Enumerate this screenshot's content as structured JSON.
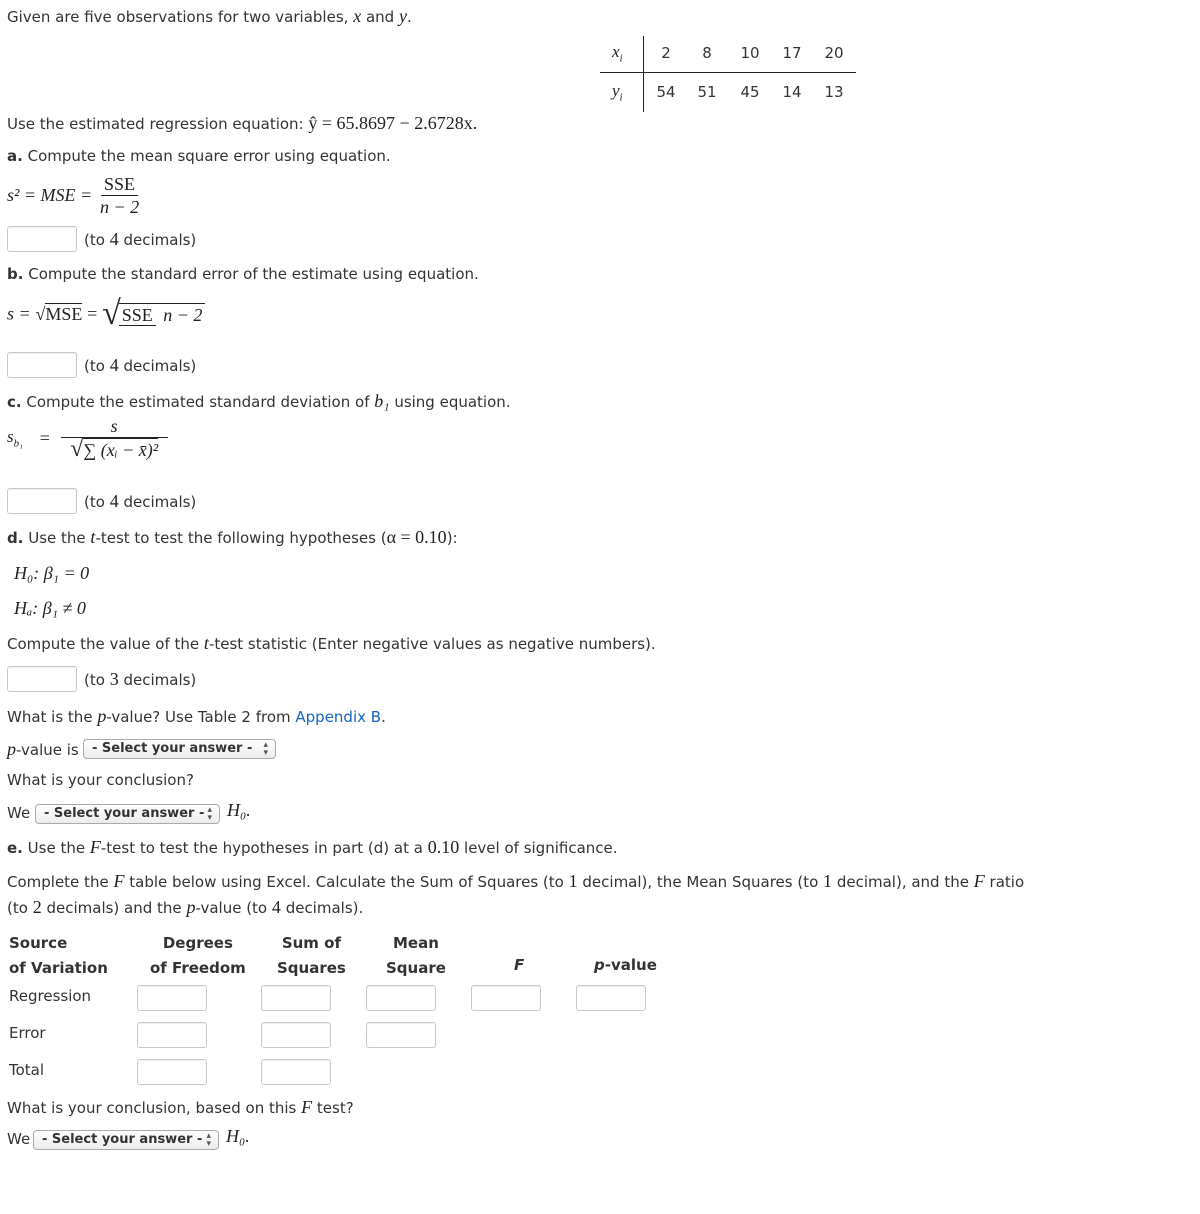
{
  "intro": {
    "text": "Given are five observations for two variables,",
    "var_x": "x",
    "and": "and",
    "var_y": "y",
    "period": "."
  },
  "observations": {
    "x_label": "x",
    "x_sub": "i",
    "y_label": "y",
    "y_sub": "i",
    "x_values": [
      "2",
      "8",
      "10",
      "17",
      "20"
    ],
    "y_values": [
      "54",
      "51",
      "45",
      "14",
      "13"
    ]
  },
  "regression": {
    "prefix": "Use the estimated regression equation:",
    "equation": "ŷ = 65.8697 − 2.6728x."
  },
  "part_a": {
    "letter": "a.",
    "text": "Compute the mean square error using equation.",
    "lhs": "s² = MSE =",
    "num": "SSE",
    "den": "n − 2",
    "input_value": "",
    "hint_pre": "(to",
    "hint_num": "4",
    "hint_post": "decimals)"
  },
  "part_b": {
    "letter": "b.",
    "text": "Compute the standard error of the estimate using equation.",
    "lhs_s": "s =",
    "mse": "MSE",
    "eq": "=",
    "num": "SSE",
    "den": "n − 2",
    "input_value": "",
    "hint_pre": "(to",
    "hint_num": "4",
    "hint_post": "decimals)"
  },
  "part_c": {
    "letter": "c.",
    "text_pre": "Compute the estimated standard deviation of",
    "b1": "b₁",
    "text_post": "using equation.",
    "lhs": "s",
    "lhs_sub": "b₁",
    "eq": "=",
    "num": "s",
    "den": "∑ (xᵢ − x̄)²",
    "input_value": "",
    "hint_pre": "(to",
    "hint_num": "4",
    "hint_post": "decimals)"
  },
  "part_d": {
    "letter": "d.",
    "text_pre": "Use the",
    "t": "t",
    "text_mid": "-test to test the following hypotheses (",
    "alpha": "α = 0.10",
    "text_post": "):",
    "h0": "H₀:  β₁ = 0",
    "ha": "Hₐ:  β₁ ≠ 0",
    "compute_pre": "Compute the value of the",
    "compute_post": "-test statistic (Enter negative values as negative numbers).",
    "input_value": "",
    "hint_pre": "(to",
    "hint_num": "3",
    "hint_post": "decimals)",
    "pvalue_q_pre": "What is the",
    "p": "p",
    "pvalue_q_mid": "-value? Use Table 2 from",
    "appendix_link": "Appendix B",
    "pvalue_q_post": ".",
    "pvalue_is": "-value is",
    "pvalue_select": "- Select your answer -",
    "conclusion_q": "What is your conclusion?",
    "we": "We",
    "conclusion_select": "- Select your answer -",
    "h0_end": "H₀."
  },
  "part_e": {
    "letter": "e.",
    "text_pre": "Use the",
    "F": "F",
    "text_mid": "-test to test the hypotheses in part (d) at a",
    "level": "0.10",
    "text_post": "level of significance.",
    "complete_1": "Complete the",
    "complete_2": "table below using Excel. Calculate the Sum of Squares (to",
    "one_a": "1",
    "complete_3": "decimal), the Mean Squares (to",
    "one_b": "1",
    "complete_4": "decimal), and the",
    "complete_5": "ratio (to",
    "two": "2",
    "complete_6": "decimals) and the",
    "complete_7": "-value (to",
    "four": "4",
    "complete_8": "decimals).",
    "table": {
      "headers": [
        [
          "Source",
          "of Variation"
        ],
        [
          "Degrees",
          "of Freedom"
        ],
        [
          "Sum of",
          "Squares"
        ],
        [
          "Mean",
          "Square"
        ],
        [
          "",
          "F"
        ],
        [
          "",
          "p-value"
        ]
      ],
      "rows": [
        {
          "label": "Regression",
          "values": [
            "",
            "",
            "",
            "",
            ""
          ]
        },
        {
          "label": "Error",
          "values": [
            "",
            "",
            ""
          ]
        },
        {
          "label": "Total",
          "values": [
            "",
            ""
          ]
        }
      ]
    },
    "conclusion_q_pre": "What is your conclusion, based on this",
    "conclusion_q_post": "test?",
    "we": "We",
    "conclusion_select": "- Select your answer -",
    "h0_end": "H₀."
  }
}
